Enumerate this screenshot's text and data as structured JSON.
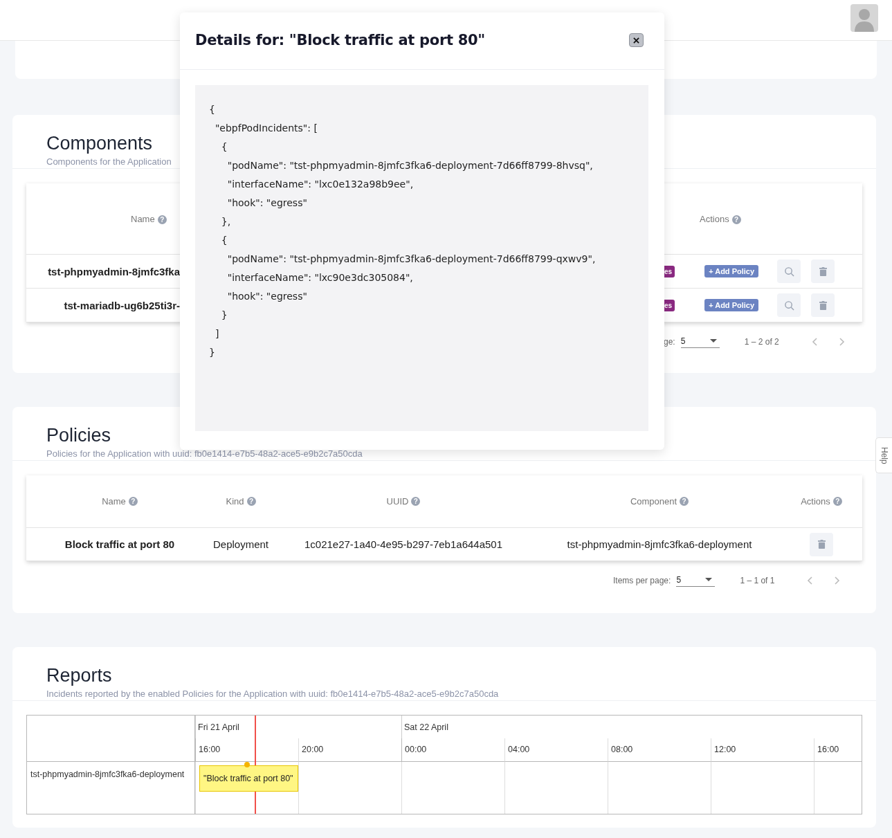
{
  "components": {
    "title": "Components",
    "subtitle": "Components for the Application",
    "columns": [
      {
        "label": "Name",
        "help": "?"
      },
      {
        "label": "Actions",
        "help": "?"
      }
    ],
    "rows": [
      {
        "name": "tst-phpmyadmin-8jmfc3fka",
        "badge": "es",
        "add_button": "+ Add Policy"
      },
      {
        "name": "tst-mariadb-ug6b25ti3r-",
        "badge": "es",
        "add_button": "+ Add Policy"
      }
    ],
    "pagination": {
      "items_label": "ge:",
      "per_page": "5",
      "range": "1 – 2 of 2"
    }
  },
  "policies": {
    "title": "Policies",
    "subtitle": "Policies for the Application with uuid: fb0e1414-e7b5-48a2-ace5-e9b2c7a50cda",
    "columns": [
      {
        "label": "Name",
        "help": "?"
      },
      {
        "label": "Kind",
        "help": "?"
      },
      {
        "label": "UUID",
        "help": "?"
      },
      {
        "label": "Component",
        "help": "?"
      },
      {
        "label": "Actions",
        "help": "?"
      }
    ],
    "rows": [
      {
        "name": "Block traffic at port 80",
        "kind": "Deployment",
        "uuid": "1c021e27-1a40-4e95-b297-7eb1a644a501",
        "component": "tst-phpmyadmin-8jmfc3fka6-deployment"
      }
    ],
    "pagination": {
      "items_label": "Items per page:",
      "per_page": "5",
      "range": "1 – 1 of 1"
    }
  },
  "reports": {
    "title": "Reports",
    "subtitle": "Incidents reported by the enabled Policies for the Application with uuid: fb0e1414-e7b5-48a2-ace5-e9b2c7a50cda",
    "days": [
      {
        "label": "Fri 21 April",
        "hours": [
          "16:00",
          "20:00"
        ]
      },
      {
        "label": "Sat 22 April",
        "hours": [
          "00:00",
          "04:00",
          "08:00",
          "12:00",
          "16:00"
        ]
      }
    ],
    "rows": [
      {
        "label": "tst-phpmyadmin-8jmfc3fka6-deployment",
        "events": [
          {
            "label": "\"Block traffic at port 80\""
          }
        ]
      }
    ]
  },
  "modal": {
    "title": "Details for: \"Block traffic at port 80\"",
    "code": "{\n  \"ebpfPodIncidents\": [\n    {\n      \"podName\": \"tst-phpmyadmin-8jmfc3fka6-deployment-7d66ff8799-8hvsq\",\n      \"interfaceName\": \"lxc0e132a98b9ee\",\n      \"hook\": \"egress\"\n    },\n    {\n      \"podName\": \"tst-phpmyadmin-8jmfc3fka6-deployment-7d66ff8799-qxwv9\",\n      \"interfaceName\": \"lxc90e3dc305084\",\n      \"hook\": \"egress\"\n    }\n  ]\n}"
  },
  "help_tab": "Help"
}
